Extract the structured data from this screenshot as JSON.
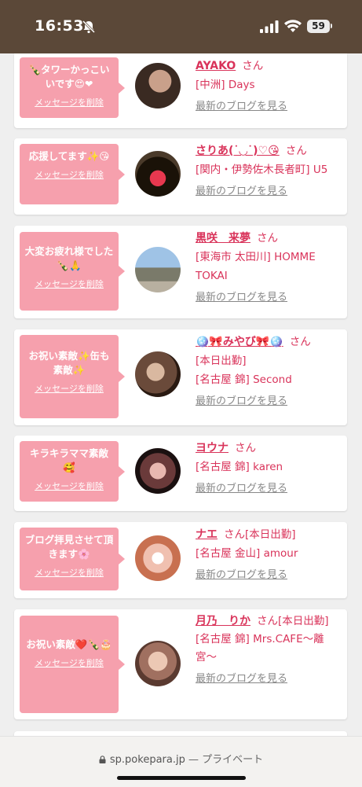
{
  "status": {
    "time": "16:53",
    "battery": "59"
  },
  "cards": [
    {
      "message": "🍾タワーかっこいいです😍❤",
      "delete": "メッセージを削除",
      "name": "AYAKO",
      "san": "さん",
      "lines": [
        "[中洲] Days"
      ],
      "blog": "最新のブログを見る"
    },
    {
      "message": "応援してます✨😘",
      "delete": "メッセージを削除",
      "name": "さりあ(˙◡˙)♡😘",
      "san": "さん",
      "lines": [
        "[関内・伊勢佐木長者町] U5"
      ],
      "blog": "最新のブログを見る"
    },
    {
      "message": "大変お疲れ様でした🍾🙏",
      "delete": "メッセージを削除",
      "name": "黒咲　来夢",
      "san": "さん",
      "lines": [
        "[東海市 太田川] HOMME TOKAI"
      ],
      "blog": "最新のブログを見る"
    },
    {
      "message": "お祝い素敵✨缶も素敵✨",
      "delete": "メッセージを削除",
      "name": "🪩🎀みやび🎀🪩",
      "san": "さん",
      "lines": [
        "[本日出勤]",
        "[名古屋 錦] Second"
      ],
      "blog": "最新のブログを見る"
    },
    {
      "message": "キラキラママ素敵🥰",
      "delete": "メッセージを削除",
      "name": "ヨウナ",
      "san": "さん",
      "lines": [
        "[名古屋 錦] karen"
      ],
      "blog": "最新のブログを見る"
    },
    {
      "message": "ブログ拝見させて頂きます🌸",
      "delete": "メッセージを削除",
      "name": "ナエ",
      "san": "さん[本日出勤]",
      "lines": [
        "[名古屋 金山] amour"
      ],
      "blog": "最新のブログを見る"
    },
    {
      "message": "お祝い素敵❤️🍾🎂",
      "delete": "メッセージを削除",
      "name": "月乃　りか",
      "san": "さん[本日出勤]",
      "lines": [
        "[名古屋 錦] Mrs.CAFE〜離宮〜"
      ],
      "blog": "最新のブログを見る"
    }
  ],
  "browser": {
    "url": "sp.pokepara.jp",
    "mode": " — プライベート"
  },
  "colors": {
    "status_bar": "#5b4838",
    "bubble": "#f6a0ad",
    "name": "#d9335a",
    "background": "#efefef"
  }
}
